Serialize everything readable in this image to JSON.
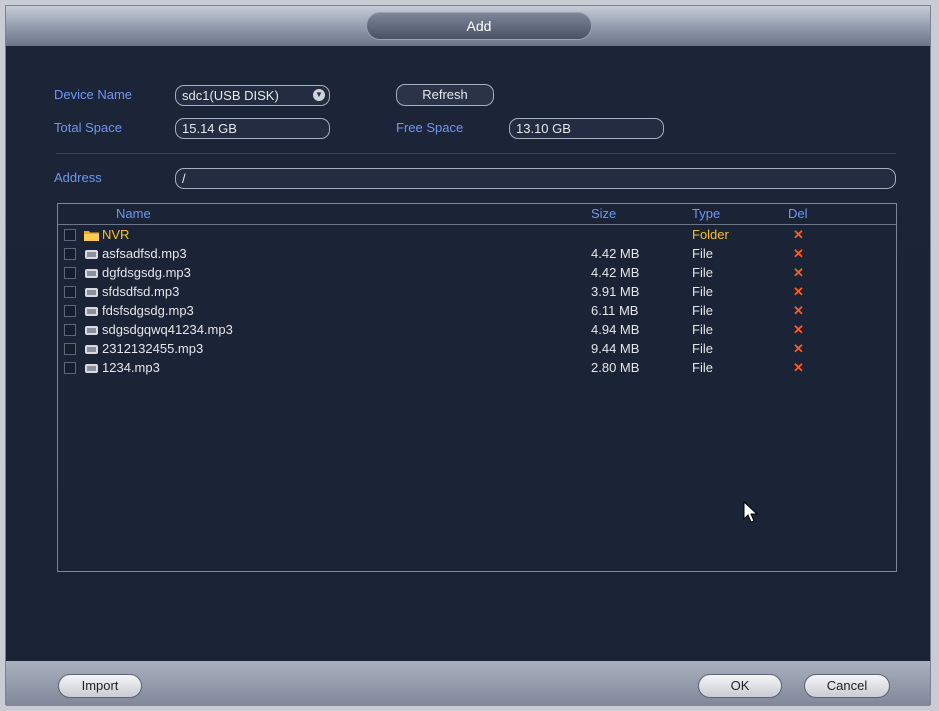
{
  "dialog": {
    "title": "Add"
  },
  "device": {
    "name_label": "Device Name",
    "name_value": "sdc1(USB DISK)",
    "refresh_label": "Refresh",
    "total_label": "Total Space",
    "total_value": "15.14 GB",
    "free_label": "Free Space",
    "free_value": "13.10 GB"
  },
  "address": {
    "label": "Address",
    "value": "/"
  },
  "table": {
    "columns": {
      "name": "Name",
      "size": "Size",
      "type": "Type",
      "del": "Del"
    },
    "rows": [
      {
        "name": "NVR",
        "size": "",
        "type": "Folder",
        "icon": "folder-icon"
      },
      {
        "name": "asfsadfsd.mp3",
        "size": "4.42 MB",
        "type": "File",
        "icon": "file-icon"
      },
      {
        "name": "dgfdsgsdg.mp3",
        "size": "4.42 MB",
        "type": "File",
        "icon": "file-icon"
      },
      {
        "name": "sfdsdfsd.mp3",
        "size": "3.91 MB",
        "type": "File",
        "icon": "file-icon"
      },
      {
        "name": "fdsfsdgsdg.mp3",
        "size": "6.11 MB",
        "type": "File",
        "icon": "file-icon"
      },
      {
        "name": "sdgsdgqwq41234.mp3",
        "size": "4.94 MB",
        "type": "File",
        "icon": "file-icon"
      },
      {
        "name": "2312132455.mp3",
        "size": "9.44 MB",
        "type": "File",
        "icon": "file-icon"
      },
      {
        "name": "1234.mp3",
        "size": "2.80 MB",
        "type": "File",
        "icon": "file-icon"
      }
    ],
    "del_glyph": "✕"
  },
  "footer": {
    "import_label": "Import",
    "ok_label": "OK",
    "cancel_label": "Cancel"
  },
  "colors": {
    "label": "#6d98f0",
    "folder_text": "#f2c12e",
    "delete": "#ff5a1f"
  }
}
